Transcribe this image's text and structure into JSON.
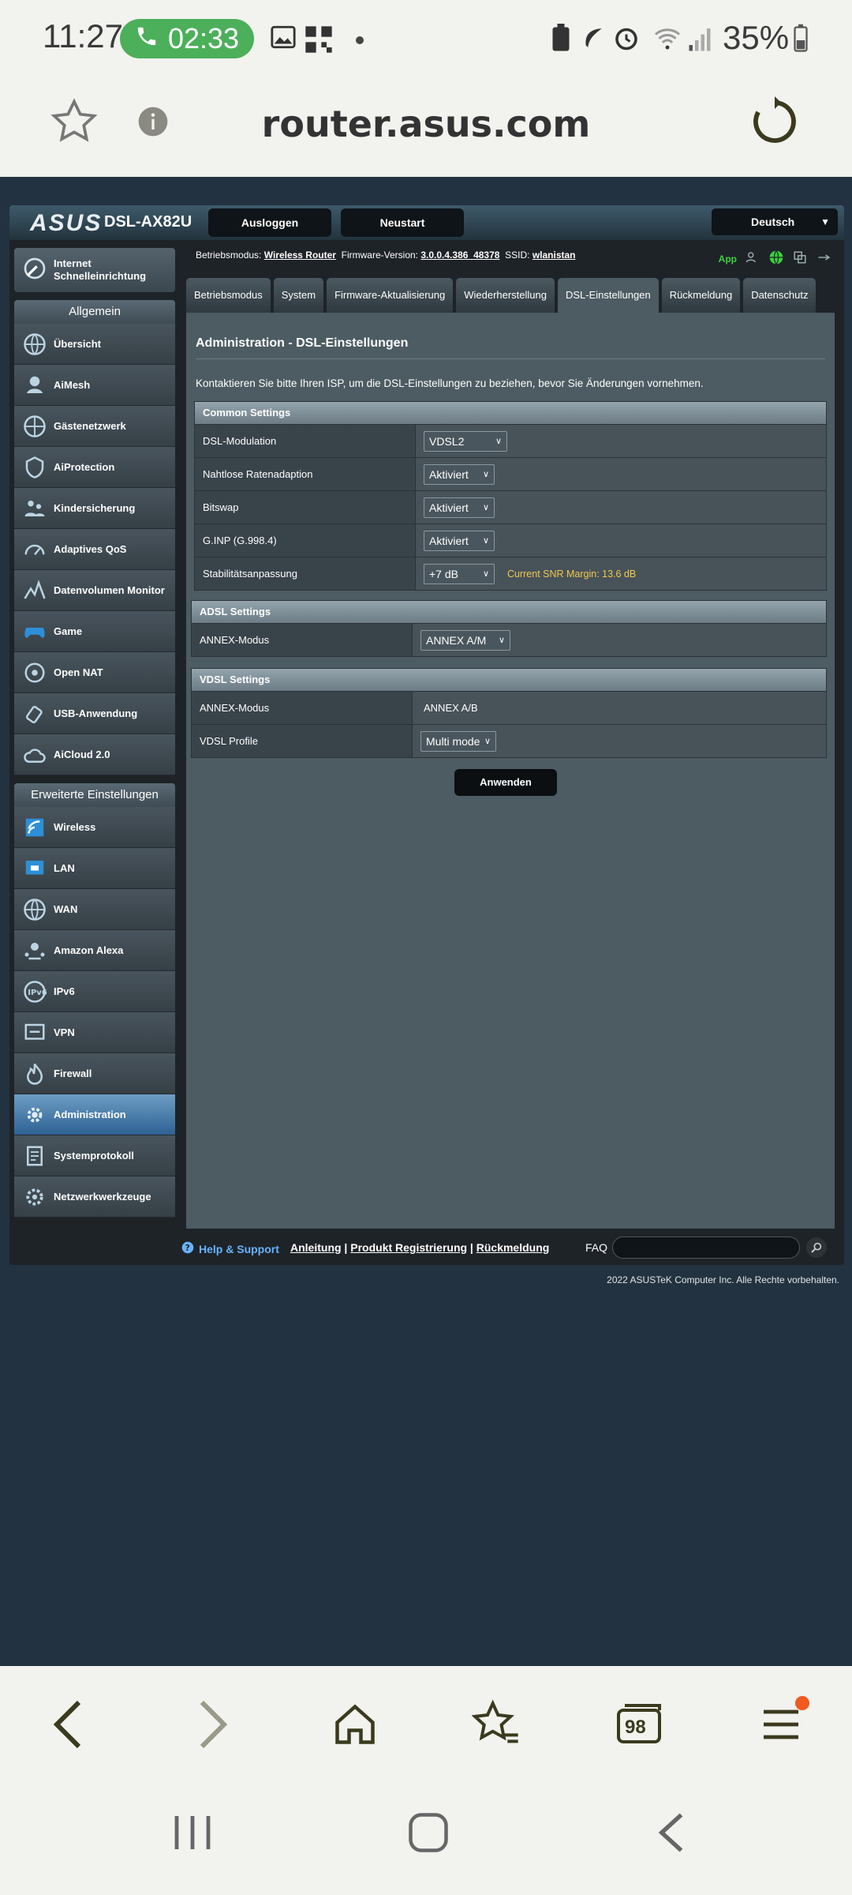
{
  "statusbar": {
    "time": "11:27",
    "call_duration": "02:33",
    "battery": "35%"
  },
  "browser": {
    "url": "router.asus.com",
    "tabs_count": "98"
  },
  "router": {
    "brand": "ASUS",
    "model": "DSL-AX82U",
    "logout_label": "Ausloggen",
    "reboot_label": "Neustart",
    "language": "Deutsch",
    "info": {
      "mode_label": "Betriebsmodus:",
      "mode_value": "Wireless Router",
      "fw_label": "Firmware-Version:",
      "fw_value": "3.0.0.4.386_48378",
      "ssid_label": "SSID:",
      "ssid_value": "wlanistan",
      "app_label": "App"
    },
    "sidebar": {
      "qis": "Internet Schnelleinrichtung",
      "general_header": "Allgemein",
      "general": [
        "Übersicht",
        "AiMesh",
        "Gästenetzwerk",
        "AiProtection",
        "Kindersicherung",
        "Adaptives QoS",
        "Datenvolumen Monitor",
        "Game",
        "Open NAT",
        "USB-Anwendung",
        "AiCloud 2.0"
      ],
      "advanced_header": "Erweiterte Einstellungen",
      "advanced": [
        "Wireless",
        "LAN",
        "WAN",
        "Amazon Alexa",
        "IPv6",
        "VPN",
        "Firewall",
        "Administration",
        "Systemprotokoll",
        "Netzwerkwerkzeuge"
      ]
    },
    "tabs": [
      "Betriebsmodus",
      "System",
      "Firmware-Aktualisierung",
      "Wiederherstellung",
      "DSL-Einstellungen",
      "Rückmeldung",
      "Datenschutz"
    ],
    "main": {
      "title": "Administration - DSL-Einstellungen",
      "description": "Kontaktieren Sie bitte Ihren ISP, um die DSL-Einstellungen zu beziehen, bevor Sie Änderungen vornehmen.",
      "common": {
        "header": "Common Settings",
        "rows": [
          {
            "label": "DSL-Modulation",
            "value": "VDSL2"
          },
          {
            "label": "Nahtlose Ratenadaption",
            "value": "Aktiviert"
          },
          {
            "label": "Bitswap",
            "value": "Aktiviert"
          },
          {
            "label": "G.INP (G.998.4)",
            "value": "Aktiviert"
          },
          {
            "label": "Stabilitätsanpassung",
            "value": "+7 dB",
            "note": "Current SNR Margin: 13.6 dB"
          }
        ]
      },
      "adsl": {
        "header": "ADSL Settings",
        "annex_label": "ANNEX-Modus",
        "annex_value": "ANNEX A/M"
      },
      "vdsl": {
        "header": "VDSL Settings",
        "annex_label": "ANNEX-Modus",
        "annex_value": "ANNEX A/B",
        "profile_label": "VDSL Profile",
        "profile_value": "Multi mode"
      },
      "apply_label": "Anwenden"
    },
    "footer": {
      "help": "Help & Support",
      "manual": "Anleitung",
      "registration": "Produkt Registrierung",
      "feedback": "Rückmeldung",
      "faq": "FAQ",
      "copyright": "2022 ASUSTeK Computer Inc. Alle Rechte vorbehalten."
    }
  },
  "colors": {
    "accent_active": "#3b6f9f",
    "snr_text": "#f2c94c",
    "call_green": "#4caf5a"
  }
}
